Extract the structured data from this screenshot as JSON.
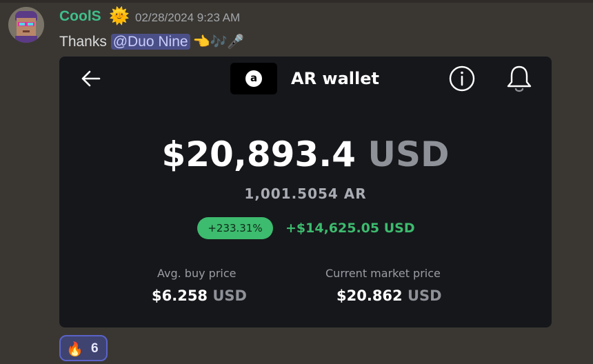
{
  "post": {
    "username": "CoolS",
    "badge_icon": "sun-badge-icon",
    "badge_glyph": "🌞",
    "timestamp": "02/28/2024 9:23 AM",
    "message_text": "Thanks ",
    "mention": "@Duo Nine",
    "emoji_trail": "👈🎶🎤"
  },
  "wallet": {
    "title": "AR wallet",
    "logo_letter": "a",
    "balance_value": "$20,893.4",
    "balance_unit": "USD",
    "ar_amount": "1,001.5054 AR",
    "pct_change": "+233.31%",
    "gain_usd": "+$14,625.05 USD",
    "avg_buy": {
      "label": "Avg. buy price",
      "value": "$6.258",
      "unit": "USD"
    },
    "market_price": {
      "label": "Current market price",
      "value": "$20.862",
      "unit": "USD"
    },
    "colors": {
      "positive": "#3dbb6e",
      "card_bg": "#16171b"
    }
  },
  "reactions": [
    {
      "emoji": "🔥",
      "count": "6"
    }
  ]
}
